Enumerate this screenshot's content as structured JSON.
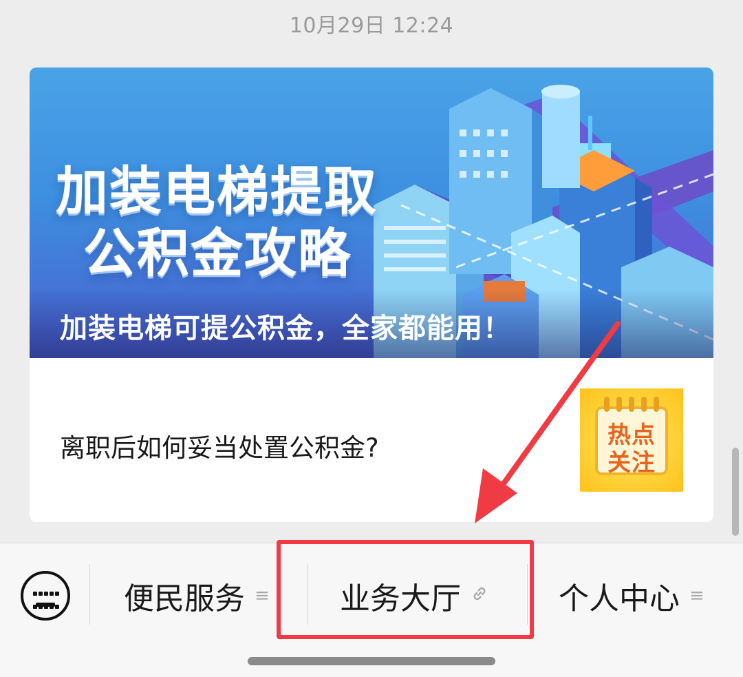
{
  "timestamp": "10月29日 12:24",
  "article_card": {
    "banner": {
      "title_line1": "加装电梯提取",
      "title_line2": "公积金攻略",
      "caption": "加装电梯可提公积金，全家都能用！"
    },
    "secondary_article": {
      "title": "离职后如何妥当处置公积金?",
      "thumbnail_text_line1": "热点",
      "thumbnail_text_line2": "关注"
    }
  },
  "menu_bar": {
    "items": [
      {
        "label": "便民服务",
        "icon": "menu-lines-icon"
      },
      {
        "label": "业务大厅",
        "icon": "link-icon"
      },
      {
        "label": "个人中心",
        "icon": "menu-lines-icon"
      }
    ],
    "highlighted_item": "业务大厅"
  },
  "colors": {
    "highlight": "#f03a44",
    "background": "#ededed"
  }
}
